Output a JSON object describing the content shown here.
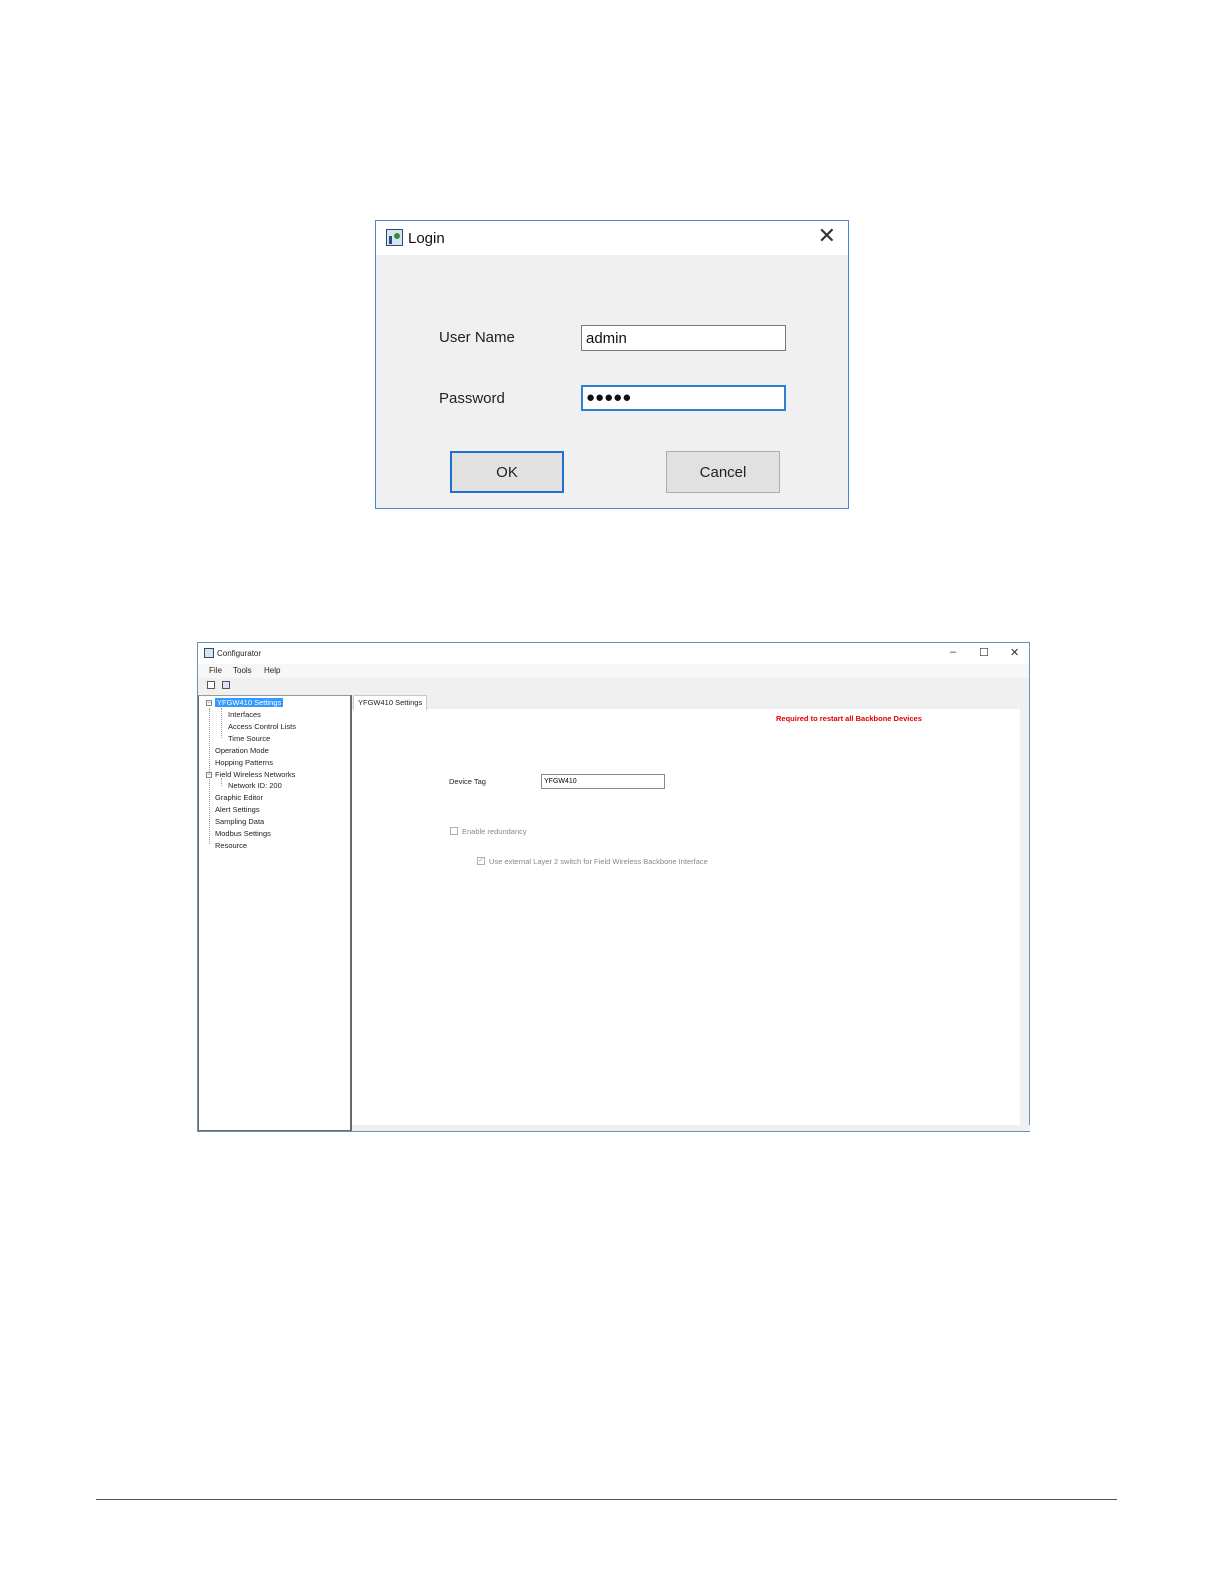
{
  "login": {
    "title": "Login",
    "close_glyph": "✕",
    "username_label": "User Name",
    "username_value": "admin",
    "password_label": "Password",
    "password_value": "●●●●●",
    "ok_label": "OK",
    "cancel_label": "Cancel"
  },
  "configurator": {
    "title": "Configurator",
    "window_buttons": {
      "minimize": "–",
      "maximize": "☐",
      "close": "✕"
    },
    "menu": [
      "File",
      "Tools",
      "Help"
    ],
    "tree": [
      "YFGW410 Settings",
      "Interfaces",
      "Access Control Lists",
      "Time Source",
      "Operation Mode",
      "Hopping Patterns",
      "Field Wireless Networks",
      "Network ID: 200",
      "Graphic Editor",
      "Alert Settings",
      "Sampling Data",
      "Modbus Settings",
      "Resource"
    ],
    "tab_label": "YFGW410 Settings",
    "warning": "Required to restart all Backbone Devices",
    "device_tag_label": "Device Tag",
    "device_tag_value": "YFGW410",
    "enable_redundancy_label": "Enable redundancy",
    "use_external_switch_label": "Use external Layer 2 switch for Field Wireless Backbone Interface",
    "expander_glyph": "−"
  }
}
